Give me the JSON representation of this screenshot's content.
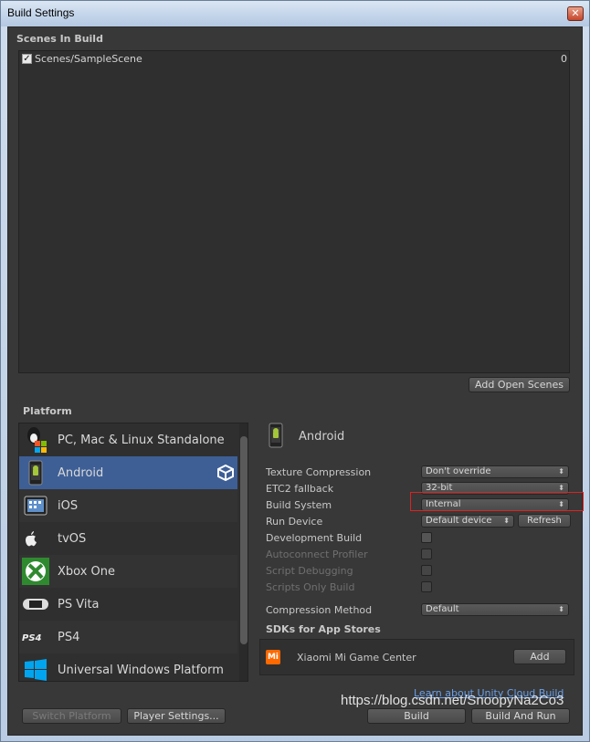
{
  "window": {
    "title": "Build Settings",
    "close_glyph": "✕"
  },
  "scenes": {
    "header": "Scenes In Build",
    "items": [
      {
        "name": "Scenes/SampleScene",
        "index": "0",
        "checked": true
      }
    ],
    "add_open_scenes_label": "Add Open Scenes"
  },
  "platform": {
    "header": "Platform",
    "items": [
      {
        "label": "PC, Mac & Linux Standalone",
        "icon": "pc-mac-linux-icon"
      },
      {
        "label": "Android",
        "icon": "android-icon",
        "selected": true
      },
      {
        "label": "iOS",
        "icon": "ios-icon"
      },
      {
        "label": "tvOS",
        "icon": "tvos-icon"
      },
      {
        "label": "Xbox One",
        "icon": "xbox-icon"
      },
      {
        "label": "PS Vita",
        "icon": "psvita-icon"
      },
      {
        "label": "PS4",
        "icon": "ps4-icon"
      },
      {
        "label": "Universal Windows Platform",
        "icon": "windows-icon"
      }
    ]
  },
  "android": {
    "title": "Android",
    "texture_compression": {
      "label": "Texture Compression",
      "value": "Don't override"
    },
    "etc2_fallback": {
      "label": "ETC2 fallback",
      "value": "32-bit"
    },
    "build_system": {
      "label": "Build System",
      "value": "Internal"
    },
    "run_device": {
      "label": "Run Device",
      "value": "Default device",
      "refresh_label": "Refresh"
    },
    "development_build": {
      "label": "Development Build"
    },
    "autoconnect_profiler": {
      "label": "Autoconnect Profiler"
    },
    "script_debugging": {
      "label": "Script Debugging"
    },
    "scripts_only_build": {
      "label": "Scripts Only Build"
    },
    "compression_method": {
      "label": "Compression Method",
      "value": "Default"
    },
    "sdks_header": "SDKs for App Stores",
    "sdk": {
      "name": "Xiaomi Mi Game Center",
      "add_label": "Add",
      "logo_text": "Mi"
    },
    "cloud_build_link": "Learn about Unity Cloud Build"
  },
  "footer": {
    "switch_platform_label": "Switch Platform",
    "player_settings_label": "Player Settings...",
    "build_label": "Build",
    "build_and_run_label": "Build And Run"
  },
  "watermark": "https://blog.csdn.net/SnoopyNa2Co3",
  "colors": {
    "selected_row": "#3e5f96",
    "highlight_border": "#dd2222",
    "link": "#6aa0e8"
  }
}
